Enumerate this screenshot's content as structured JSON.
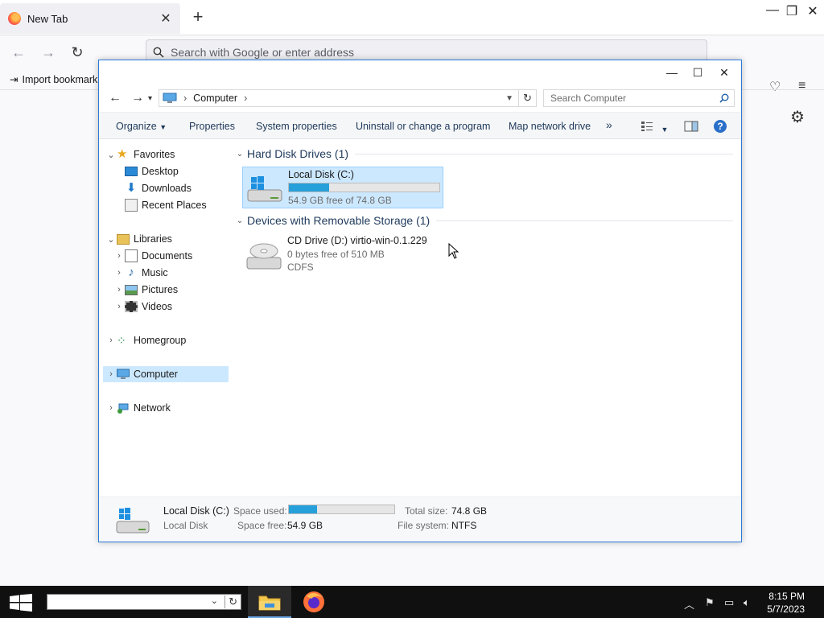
{
  "browser": {
    "tab_title": "New Tab",
    "url_placeholder": "Search with Google or enter address",
    "bookmark_import": "Import bookmark"
  },
  "explorer": {
    "breadcrumb": "Computer",
    "search_placeholder": "Search Computer",
    "toolbar": {
      "organize": "Organize",
      "properties": "Properties",
      "system_properties": "System properties",
      "uninstall": "Uninstall or change a program",
      "map_drive": "Map network drive",
      "more": "»"
    },
    "nav": {
      "favorites": "Favorites",
      "desktop": "Desktop",
      "downloads": "Downloads",
      "recent": "Recent Places",
      "libraries": "Libraries",
      "documents": "Documents",
      "music": "Music",
      "pictures": "Pictures",
      "videos": "Videos",
      "homegroup": "Homegroup",
      "computer": "Computer",
      "network": "Network"
    },
    "groups": {
      "hdd_header": "Hard Disk Drives (1)",
      "removable_header": "Devices with Removable Storage (1)"
    },
    "drives": {
      "c_name": "Local Disk (C:)",
      "c_free": "54.9 GB free of 74.8 GB",
      "c_used_fraction": 0.266,
      "d_name": "CD Drive (D:) virtio-win-0.1.229",
      "d_free": "0 bytes free of 510 MB",
      "d_fs": "CDFS"
    },
    "details": {
      "name": "Local Disk (C:)",
      "type": "Local Disk",
      "space_used_label": "Space used:",
      "space_free_label": "Space free:",
      "space_free": "54.9 GB",
      "total_size_label": "Total size:",
      "total_size": "74.8 GB",
      "fs_label": "File system:",
      "fs": "NTFS",
      "used_fraction": 0.266
    }
  },
  "taskbar": {
    "time": "8:15 PM",
    "date": "5/7/2023"
  },
  "colors": {
    "accent": "#26a0da",
    "selection": "#cce8ff"
  }
}
